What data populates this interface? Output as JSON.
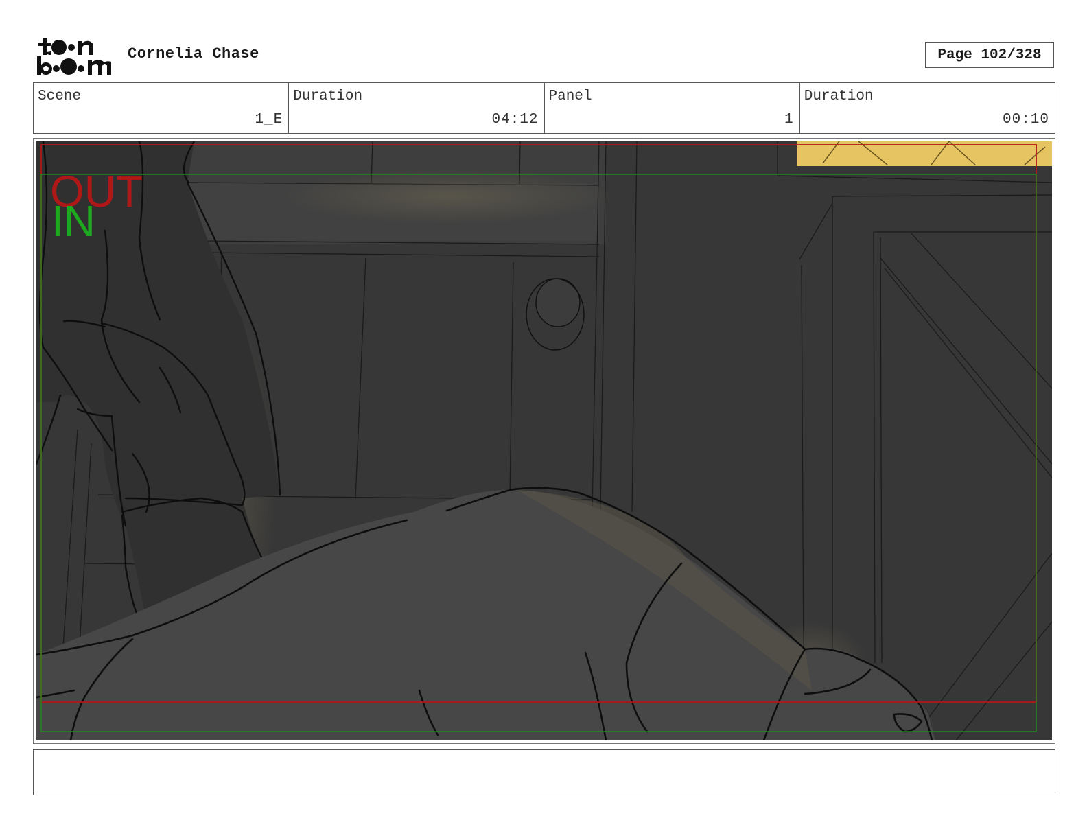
{
  "header": {
    "logo_text": "toon boom",
    "project_title": "Cornelia Chase",
    "page_label": "Page 102/328"
  },
  "info": {
    "scene_label": "Scene",
    "scene_value": "1_E",
    "scene_duration_label": "Duration",
    "scene_duration_value": "04:12",
    "panel_label": "Panel",
    "panel_value": "1",
    "panel_duration_label": "Duration",
    "panel_duration_value": "00:10"
  },
  "panel": {
    "out_label": "OUT",
    "in_label": "IN",
    "colors": {
      "background": "#3a3a3a",
      "line": "#111111",
      "highlight": "#e8c766",
      "out_frame": "#b01818",
      "in_frame": "#1e8c1e"
    }
  },
  "notes": {
    "text": ""
  }
}
